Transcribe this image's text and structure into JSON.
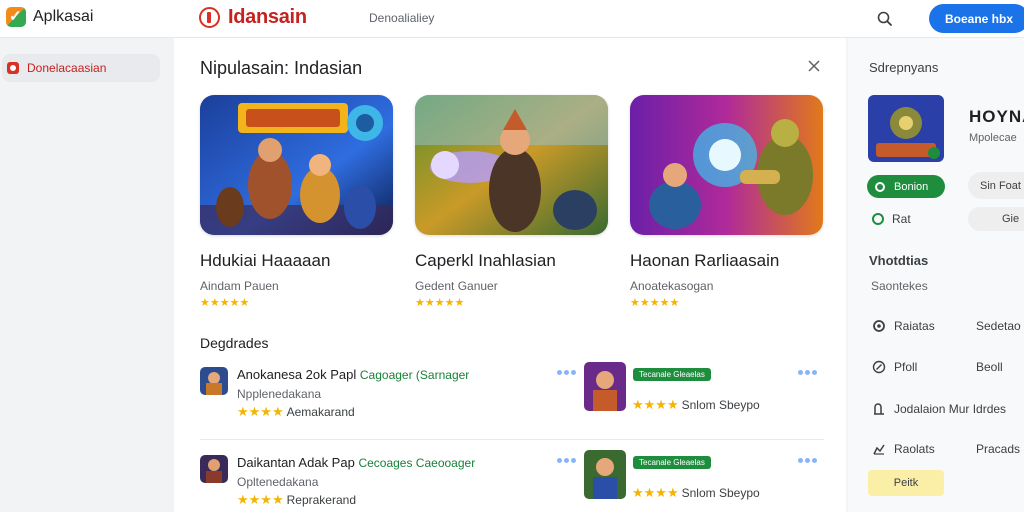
{
  "topbar": {
    "brand_name": "Aplkasai",
    "site_name": "Idansain",
    "nav_link": "Denoalialiey",
    "cta_label": "Boeane hbx"
  },
  "sidebar": {
    "items": [
      {
        "label": "Donelacaasian"
      }
    ]
  },
  "main": {
    "title": "Nipulasain: Indasian",
    "featured": [
      {
        "title": "Hdukiai Haaaaan",
        "subtitle": "Aindam Pauen",
        "stars": "★★★★★"
      },
      {
        "title": "Caperkl Inahlasian",
        "subtitle": "Gedent Ganuer",
        "stars": "★★★★★"
      },
      {
        "title": "Haonan Rarliaasain",
        "subtitle": "Anoatekasogan",
        "stars": "★★★★★"
      }
    ],
    "section_title": "Degdrades",
    "rows": [
      {
        "title": "Anokanesa 2ok Papl",
        "tag": "Cagoager (Sarnager",
        "subtitle": "Npplenedakana",
        "stars": "★★★★",
        "rating_label": "Aemakarand",
        "badge": "Tecanale Gleaelas",
        "rating2_stars": "★★★★",
        "rating2_label": "Snlom Sbeypo"
      },
      {
        "title": "Daikantan Adak Pap",
        "tag": "Cecoages Caeooager",
        "subtitle": "Opltenedakana",
        "stars": "★★★★",
        "rating_label": "Reprakerand",
        "badge": "Tecanale Gleaelas",
        "rating2_stars": "★★★★",
        "rating2_label": "Snlom Sbeypo"
      }
    ]
  },
  "rightpanel": {
    "title": "Sdrepnyans",
    "app_name": "HOYNA",
    "app_sub": "Mpolecae",
    "install_label": "Bonion",
    "ghost1_label": "Sin Foat",
    "fav_label": "Rat",
    "ghost2_label": "Gie",
    "section2_title": "Vhotdtias",
    "section2_sub": "Saontekes",
    "items": [
      {
        "left": "Raiatas",
        "right": "Sedetao"
      },
      {
        "left": "Pfoll",
        "right": "Beoll"
      },
      {
        "left": "Jodalaion Mur Idrdes",
        "right": ""
      },
      {
        "left": "Raolats",
        "right": "Pracads"
      }
    ],
    "yellow_label": "Peitk"
  },
  "colors": {
    "accent_blue": "#1a73e8",
    "brand_red": "#c5221f",
    "green": "#1e8e3e",
    "star": "#f4b400"
  }
}
